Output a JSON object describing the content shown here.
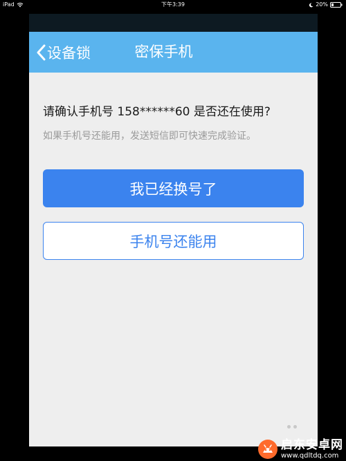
{
  "status_bar": {
    "device": "iPad",
    "time": "下午3:39",
    "battery": "20%"
  },
  "nav": {
    "back_label": "设备锁",
    "title": "密保手机"
  },
  "content": {
    "question": "请确认手机号 158******60 是否还在使用?",
    "hint": "如果手机号还能用，发送短信即可快速完成验证。"
  },
  "buttons": {
    "changed_number": "我已经换号了",
    "still_usable": "手机号还能用"
  },
  "watermark": {
    "name": "启东安卓网",
    "url": "www.qdltdq.com"
  },
  "colors": {
    "nav_bg": "#5ab4ee",
    "primary": "#3b83ee",
    "screen_bg": "#eeeeee"
  }
}
